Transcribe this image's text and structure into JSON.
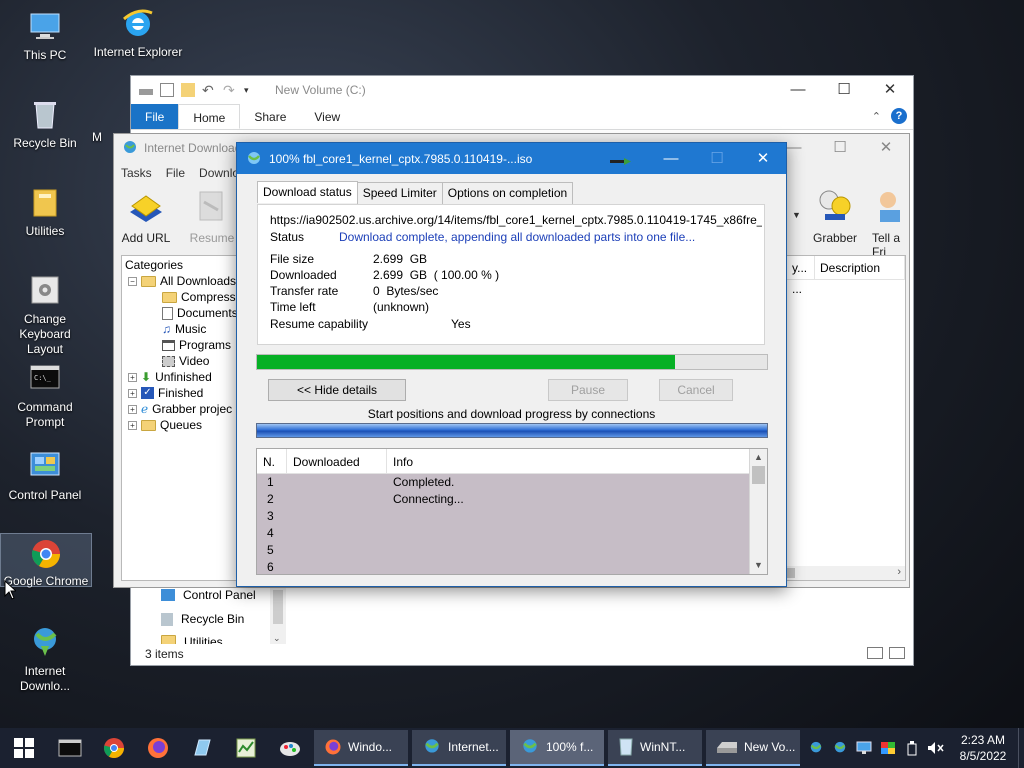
{
  "desktop": {
    "icons": [
      {
        "label": "This PC"
      },
      {
        "label": "Internet Explorer"
      },
      {
        "label": "Recycle Bin"
      },
      {
        "label": "M"
      },
      {
        "label": "Utilities"
      },
      {
        "label": "Change Keyboard Layout"
      },
      {
        "label": "Command Prompt"
      },
      {
        "label": "Control Panel"
      },
      {
        "label": "Google Chrome"
      },
      {
        "label": "Internet Downlo..."
      }
    ]
  },
  "explorer": {
    "title": "New Volume (C:)",
    "tabs": {
      "file": "File",
      "home": "Home",
      "share": "Share",
      "view": "View"
    },
    "help": "?",
    "nav": {
      "control_panel": "Control Panel",
      "recycle_bin": "Recycle Bin",
      "utilities": "Utilities"
    },
    "status": "3 items"
  },
  "idm_main": {
    "title": "Internet Download",
    "menu": {
      "tasks": "Tasks",
      "file": "File",
      "downloads": "Downlo"
    },
    "toolbar": {
      "add_url": "Add URL",
      "resume": "Resume",
      "grabber": "Grabber",
      "tell_friend": "Tell a Fri"
    },
    "categories_header": "Categories",
    "tree": {
      "all_downloads": "All Downloads",
      "compressed": "Compresse",
      "documents": "Documents",
      "music": "Music",
      "programs": "Programs",
      "video": "Video",
      "unfinished": "Unfinished",
      "finished": "Finished",
      "grabber_projects": "Grabber projec",
      "queues": "Queues"
    },
    "list_columns": {
      "last_try": "y...",
      "description": "Description"
    },
    "list_cell": "..."
  },
  "dialog": {
    "title": "100% fbl_core1_kernel_cptx.7985.0.110419-...iso",
    "tabs": {
      "status": "Download status",
      "speed": "Speed Limiter",
      "options": "Options on completion"
    },
    "url": "https://ia902502.us.archive.org/14/items/fbl_core1_kernel_cptx.7985.0.110419-1745_x86fre_clien",
    "status_label": "Status",
    "status_value": "Download complete, appending all downloaded parts into one file...",
    "file_size_label": "File size",
    "file_size_value": "2.699  GB",
    "downloaded_label": "Downloaded",
    "downloaded_value": "2.699  GB  ( 100.00 % )",
    "transfer_rate_label": "Transfer rate",
    "transfer_rate_value": "0  Bytes/sec",
    "time_left_label": "Time left",
    "time_left_value": "(unknown)",
    "resume_label": "Resume capability",
    "resume_value": "Yes",
    "progress_fraction": 0.82,
    "buttons": {
      "hide_details": "<< Hide details",
      "pause": "Pause",
      "cancel": "Cancel"
    },
    "connections_title": "Start positions and download progress by connections",
    "table_headers": {
      "n": "N.",
      "downloaded": "Downloaded",
      "info": "Info"
    },
    "rows": [
      {
        "n": "1",
        "info": "Completed."
      },
      {
        "n": "2",
        "info": "Connecting..."
      },
      {
        "n": "3",
        "info": ""
      },
      {
        "n": "4",
        "info": ""
      },
      {
        "n": "5",
        "info": ""
      },
      {
        "n": "6",
        "info": ""
      }
    ]
  },
  "taskbar": {
    "tasks": [
      {
        "label": "Windo..."
      },
      {
        "label": "Internet..."
      },
      {
        "label": "100% f..."
      },
      {
        "label": "WinNT..."
      },
      {
        "label": "New Vo..."
      }
    ],
    "time": "2:23 AM",
    "date": "8/5/2022"
  },
  "colors": {
    "accent": "#1f78d1",
    "progress": "#06b025",
    "taskbar": "#1b2130"
  }
}
